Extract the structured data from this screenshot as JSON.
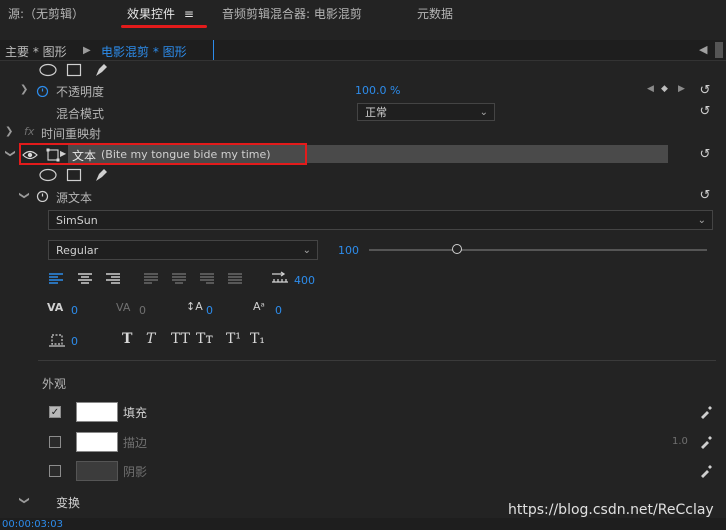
{
  "tabs": [
    {
      "label": "源:（无剪辑）"
    },
    {
      "label": "效果控件"
    },
    {
      "label": "音频剪辑混合器: 电影混剪"
    },
    {
      "label": "元数据"
    }
  ],
  "tab_menu_icon": "≡",
  "sequence": {
    "main_label": "主要 * 图形",
    "clip_label": "电影混剪 * 图形"
  },
  "opacity": {
    "label": "不透明度",
    "value": "100.0 %"
  },
  "blend": {
    "label": "混合模式",
    "value": "正常"
  },
  "time_remap": {
    "label": "时间重映射",
    "fx": "fx"
  },
  "text_layer": {
    "label": "文本",
    "detail": "(Bite my tongue bide my time)"
  },
  "source_text": {
    "label": "源文本"
  },
  "font": {
    "family": "SimSun",
    "style": "Regular",
    "size": "100",
    "size_slider_pct": 0.26
  },
  "tab_stop_value": "400",
  "metrics": {
    "kerning": "0",
    "tracking": "0",
    "leading": "0",
    "baseline": "0",
    "tsume": "0"
  },
  "style_buttons": [
    "T",
    "T",
    "TT",
    "Tт",
    "T¹",
    "T₁"
  ],
  "appearance": {
    "header": "外观",
    "fill": {
      "label": "填充",
      "checked": true,
      "color": "#ffffff"
    },
    "stroke": {
      "label": "描边",
      "checked": false,
      "color": "#ffffff",
      "width": "1.0"
    },
    "shadow": {
      "label": "阴影",
      "checked": false
    }
  },
  "transform": {
    "label": "变换"
  },
  "timecode": "00:00:03:03",
  "watermark": "https://blog.csdn.net/ReCclay",
  "colors": {
    "accent": "#2d8ceb",
    "highlight": "#e31b1b",
    "panel": "#232323"
  }
}
